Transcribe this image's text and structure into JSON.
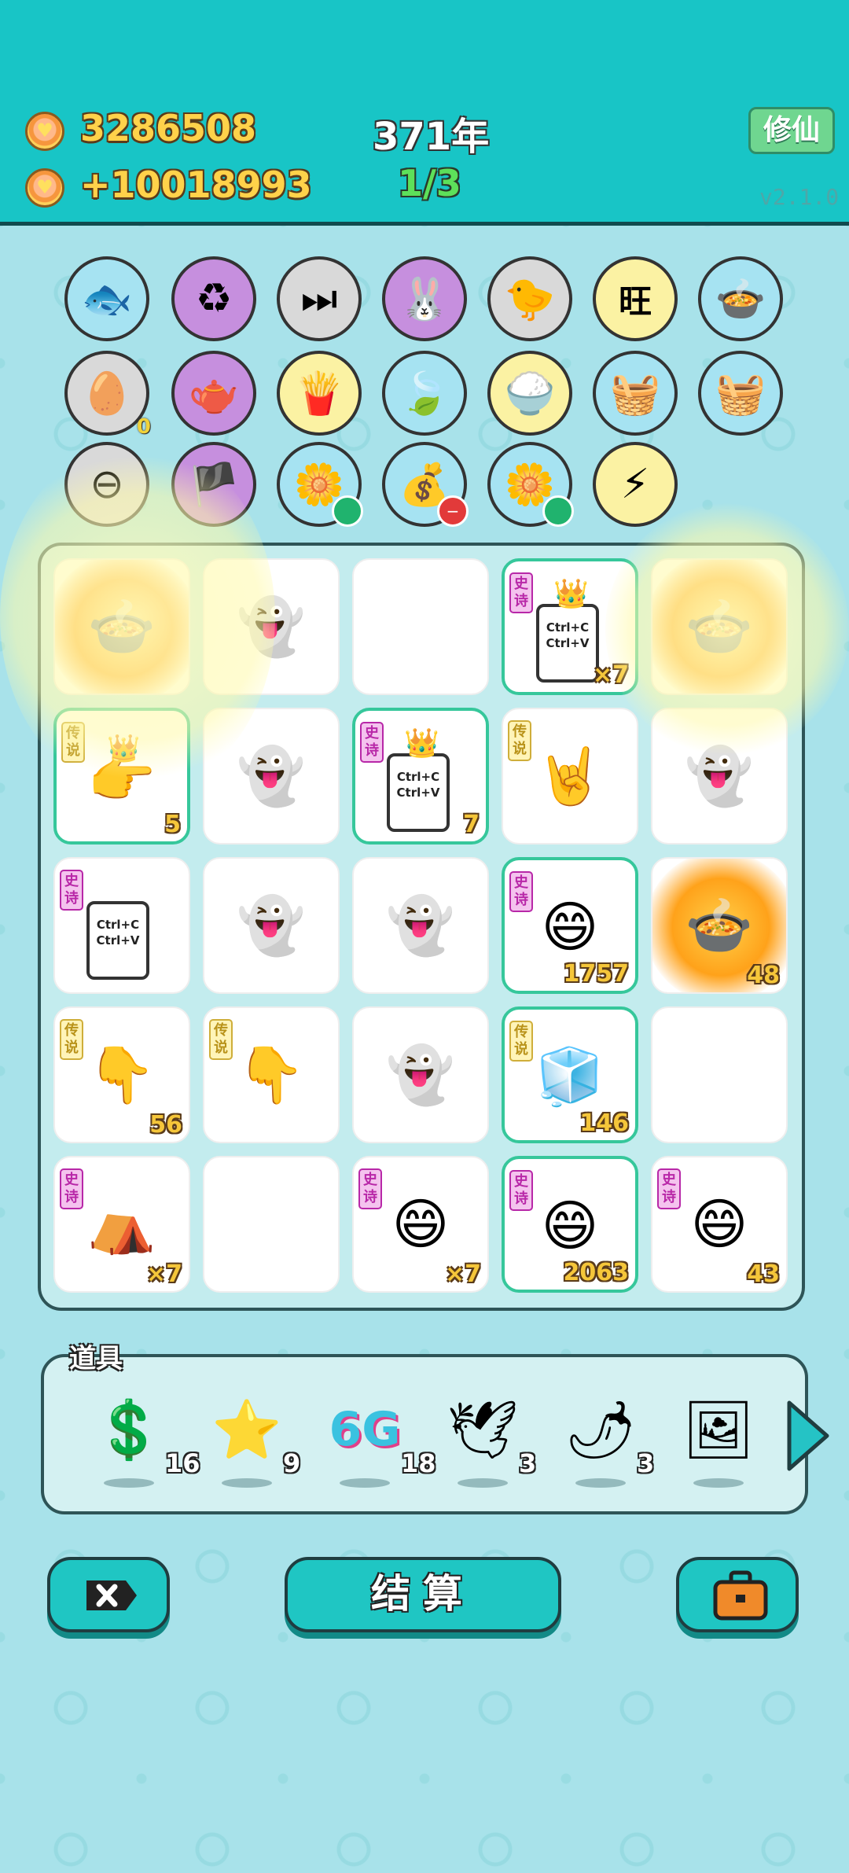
{
  "header": {
    "coins": "3286508",
    "income": "+10018993",
    "year": "371年",
    "progress": "1/3",
    "xiuxian_label": "修仙",
    "version": "v2.1.0"
  },
  "circle_items": [
    {
      "name": "fishbowl-icon",
      "glyph": "🐟",
      "bg": "#a6e3f2"
    },
    {
      "name": "recycle-icon",
      "glyph": "♻",
      "bg": "#c68fde"
    },
    {
      "name": "skip-icon",
      "glyph": "⏭",
      "bg": "#d9d9d9"
    },
    {
      "name": "rabbit-icon",
      "glyph": "🐰",
      "bg": "#c68fde"
    },
    {
      "name": "chick-egg-icon",
      "glyph": "🐤",
      "bg": "#d9d9d9"
    },
    {
      "name": "wang-tiles-icon",
      "glyph": "旺",
      "bg": "#fbf2a3"
    },
    {
      "name": "pot-icon",
      "glyph": "🍲",
      "bg": "#a6e3f2"
    },
    {
      "name": "egg-tray-icon",
      "glyph": "🥚",
      "bg": "#d9d9d9",
      "count": "0"
    },
    {
      "name": "gravy-boat-icon",
      "glyph": "🫖",
      "bg": "#c68fde"
    },
    {
      "name": "fries-icon",
      "glyph": "🍟",
      "bg": "#fbf2a3"
    },
    {
      "name": "leaf-icon",
      "glyph": "🍃",
      "bg": "#a6e3f2"
    },
    {
      "name": "rice-bowl-icon",
      "glyph": "🍚",
      "bg": "#fbf2a3"
    },
    {
      "name": "fruit-basket-icon",
      "glyph": "🧺",
      "bg": "#a6e3f2"
    },
    {
      "name": "fruit-basket-icon",
      "glyph": "🧺",
      "bg": "#a6e3f2"
    },
    {
      "name": "minus-circle-icon",
      "glyph": "⊖",
      "bg": "#d9d9d9"
    },
    {
      "name": "eye-patch-icon",
      "glyph": "🏴",
      "bg": "#c68fde"
    },
    {
      "name": "flower-pot-icon",
      "glyph": "🌼",
      "bg": "#a6e3f2"
    },
    {
      "name": "sack-icon",
      "glyph": "💰",
      "bg": "#a6e3f2"
    },
    {
      "name": "flower-pot-icon",
      "glyph": "🌼",
      "bg": "#a6e3f2"
    },
    {
      "name": "lightning-icon",
      "glyph": "⚡",
      "bg": "#fbf2a3"
    }
  ],
  "tiles": [
    {
      "name": "pot-fire",
      "glyph": "",
      "count": "",
      "tag": "",
      "green": false
    },
    {
      "name": "ghost-coins",
      "glyph": "👻",
      "count": "",
      "tag": "",
      "green": false
    },
    {
      "name": "empty",
      "glyph": "",
      "count": "",
      "tag": "",
      "green": false
    },
    {
      "name": "ctrl-card",
      "glyph": "card",
      "count": "×7",
      "tag": "史诗",
      "tagtype": "epic",
      "green": true,
      "crown": true
    },
    {
      "name": "pot-fire",
      "glyph": "",
      "count": "",
      "tag": "",
      "green": false
    },
    {
      "name": "crown-hand",
      "glyph": "👉",
      "count": "5",
      "tag": "传说",
      "tagtype": "legend",
      "green": true,
      "crown": true
    },
    {
      "name": "ghost-coins",
      "glyph": "👻",
      "count": "",
      "tag": "",
      "green": false
    },
    {
      "name": "ctrl-card",
      "glyph": "card",
      "count": "7",
      "tag": "史诗",
      "tagtype": "epic",
      "green": true,
      "crown": true
    },
    {
      "name": "rock-hand",
      "glyph": "🤘",
      "count": "",
      "tag": "传说",
      "tagtype": "legend",
      "green": false
    },
    {
      "name": "ghost-coins",
      "glyph": "👻",
      "count": "",
      "tag": "",
      "green": false
    },
    {
      "name": "ctrl-card",
      "glyph": "card",
      "count": "",
      "tag": "史诗",
      "tagtype": "epic",
      "green": false
    },
    {
      "name": "ghost-coins",
      "glyph": "👻",
      "count": "",
      "tag": "",
      "green": false
    },
    {
      "name": "ghost-coins",
      "glyph": "👻",
      "count": "",
      "tag": "",
      "green": false
    },
    {
      "name": "face-crown",
      "glyph": "😄",
      "count": "1757",
      "tag": "史诗",
      "tagtype": "epic",
      "green": true
    },
    {
      "name": "pot-fire",
      "glyph": "",
      "count": "48",
      "tag": "",
      "green": false
    },
    {
      "name": "point-hand",
      "glyph": "👇",
      "count": "56",
      "tag": "传说",
      "tagtype": "legend",
      "green": false
    },
    {
      "name": "point-hand",
      "glyph": "👇",
      "count": "",
      "tag": "传说",
      "tagtype": "legend",
      "green": false
    },
    {
      "name": "ghost-coins",
      "glyph": "👻",
      "count": "",
      "tag": "",
      "green": false
    },
    {
      "name": "fridge",
      "glyph": "🧊",
      "count": "146",
      "tag": "传说",
      "tagtype": "legend",
      "green": true
    },
    {
      "name": "empty",
      "glyph": "",
      "count": "",
      "tag": "",
      "green": false
    },
    {
      "name": "rabbit-tent",
      "glyph": "⛺",
      "count": "×7",
      "tag": "史诗",
      "tagtype": "epic",
      "green": false
    },
    {
      "name": "empty",
      "glyph": "",
      "count": "",
      "tag": "",
      "green": false
    },
    {
      "name": "face",
      "glyph": "😄",
      "count": "×7",
      "tag": "史诗",
      "tagtype": "epic",
      "green": false
    },
    {
      "name": "face",
      "glyph": "😄",
      "count": "2063",
      "tag": "史诗",
      "tagtype": "epic",
      "green": true
    },
    {
      "name": "face",
      "glyph": "😄",
      "count": "43",
      "tag": "史诗",
      "tagtype": "epic",
      "green": false
    }
  ],
  "props": {
    "title": "道具",
    "items": [
      {
        "name": "dollar-coin-icon",
        "glyph": "💲",
        "count": "16"
      },
      {
        "name": "star-icon",
        "glyph": "⭐",
        "count": "9"
      },
      {
        "name": "6g-icon",
        "glyph": "6G",
        "count": "18"
      },
      {
        "name": "white-bird-icon",
        "glyph": "🕊",
        "count": "3"
      },
      {
        "name": "chili-icon",
        "glyph": "🌶",
        "count": "3"
      },
      {
        "name": "portrait-icon",
        "glyph": "🖼",
        "count": ""
      }
    ]
  },
  "footer": {
    "settle_label": "结算"
  }
}
